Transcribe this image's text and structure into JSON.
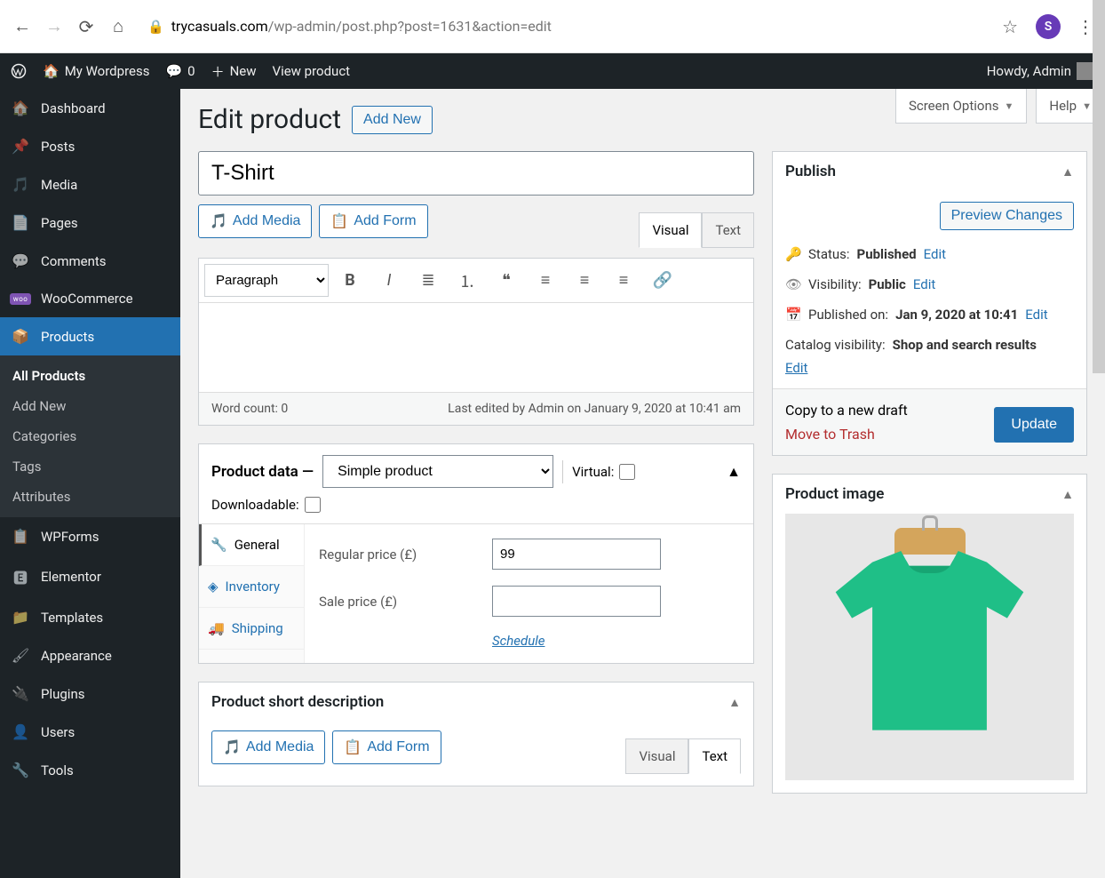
{
  "browser": {
    "domain": "trycasuals.com",
    "path": "/wp-admin/post.php?post=1631&action=edit",
    "avatar_letter": "S"
  },
  "adminbar": {
    "site_name": "My Wordpress",
    "comments": "0",
    "new": "New",
    "view_product": "View product",
    "howdy": "Howdy, Admin"
  },
  "sidebar": {
    "items": [
      {
        "label": "Dashboard",
        "icon": "dashboard"
      },
      {
        "label": "Posts",
        "icon": "pin"
      },
      {
        "label": "Media",
        "icon": "media"
      },
      {
        "label": "Pages",
        "icon": "pages"
      },
      {
        "label": "Comments",
        "icon": "comment"
      },
      {
        "label": "WooCommerce",
        "icon": "woo"
      },
      {
        "label": "Products",
        "icon": "box"
      }
    ],
    "submenu": [
      "All Products",
      "Add New",
      "Categories",
      "Tags",
      "Attributes"
    ],
    "items2": [
      {
        "label": "WPForms",
        "icon": "forms"
      },
      {
        "label": "Elementor",
        "icon": "elementor"
      },
      {
        "label": "Templates",
        "icon": "folder"
      },
      {
        "label": "Appearance",
        "icon": "brush"
      },
      {
        "label": "Plugins",
        "icon": "plugin"
      },
      {
        "label": "Users",
        "icon": "user"
      },
      {
        "label": "Tools",
        "icon": "wrench"
      }
    ]
  },
  "top_panels": {
    "screen_options": "Screen Options",
    "help": "Help"
  },
  "page": {
    "heading": "Edit product",
    "add_new": "Add New",
    "title_value": "T-Shirt"
  },
  "editor": {
    "add_media": "Add Media",
    "add_form": "Add Form",
    "tab_visual": "Visual",
    "tab_text": "Text",
    "format_select": "Paragraph",
    "word_count": "Word count: 0",
    "last_edited": "Last edited by Admin on January 9, 2020 at 10:41 am"
  },
  "product_data": {
    "heading": "Product data —",
    "type": "Simple product",
    "virtual_label": "Virtual:",
    "downloadable_label": "Downloadable:",
    "tabs": [
      "General",
      "Inventory",
      "Shipping"
    ],
    "regular_price_label": "Regular price (£)",
    "regular_price": "99",
    "sale_price_label": "Sale price (£)",
    "sale_price": "",
    "schedule": "Schedule"
  },
  "short_desc": {
    "heading": "Product short description",
    "add_media": "Add Media",
    "add_form": "Add Form",
    "tab_visual": "Visual",
    "tab_text": "Text"
  },
  "publish": {
    "heading": "Publish",
    "preview": "Preview Changes",
    "status_label": "Status:",
    "status_value": "Published",
    "visibility_label": "Visibility:",
    "visibility_value": "Public",
    "published_label": "Published on:",
    "published_value": "Jan 9, 2020 at 10:41",
    "catalog_label": "Catalog visibility:",
    "catalog_value": "Shop and search results",
    "edit": "Edit",
    "copy_draft": "Copy to a new draft",
    "trash": "Move to Trash",
    "update": "Update"
  },
  "product_image": {
    "heading": "Product image"
  }
}
